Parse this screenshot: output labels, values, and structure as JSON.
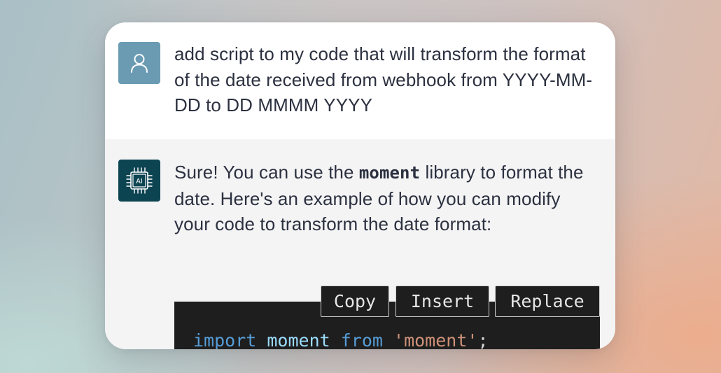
{
  "conversation": {
    "user_message": {
      "avatar_icon": "user-icon",
      "avatar_color": "#6a9bb3",
      "text": "add script to my code that will transform the format of the date received from webhook from YYYY-MM-DD to DD MMMM YYYY"
    },
    "ai_message": {
      "avatar_icon": "ai-chip-icon",
      "avatar_label": "AI",
      "avatar_color": "#0d4452",
      "text_before": "Sure! You can use the ",
      "text_code": "moment",
      "text_after": " library to format the date. Here's an example of how you can modify your code to transform the date format:"
    },
    "code_block": {
      "buttons": {
        "copy": "Copy",
        "insert": "Insert",
        "replace": "Replace"
      },
      "line": {
        "keyword1": "import",
        "identifier": "moment",
        "keyword2": "from",
        "string": "'moment'",
        "end": ";"
      }
    }
  }
}
